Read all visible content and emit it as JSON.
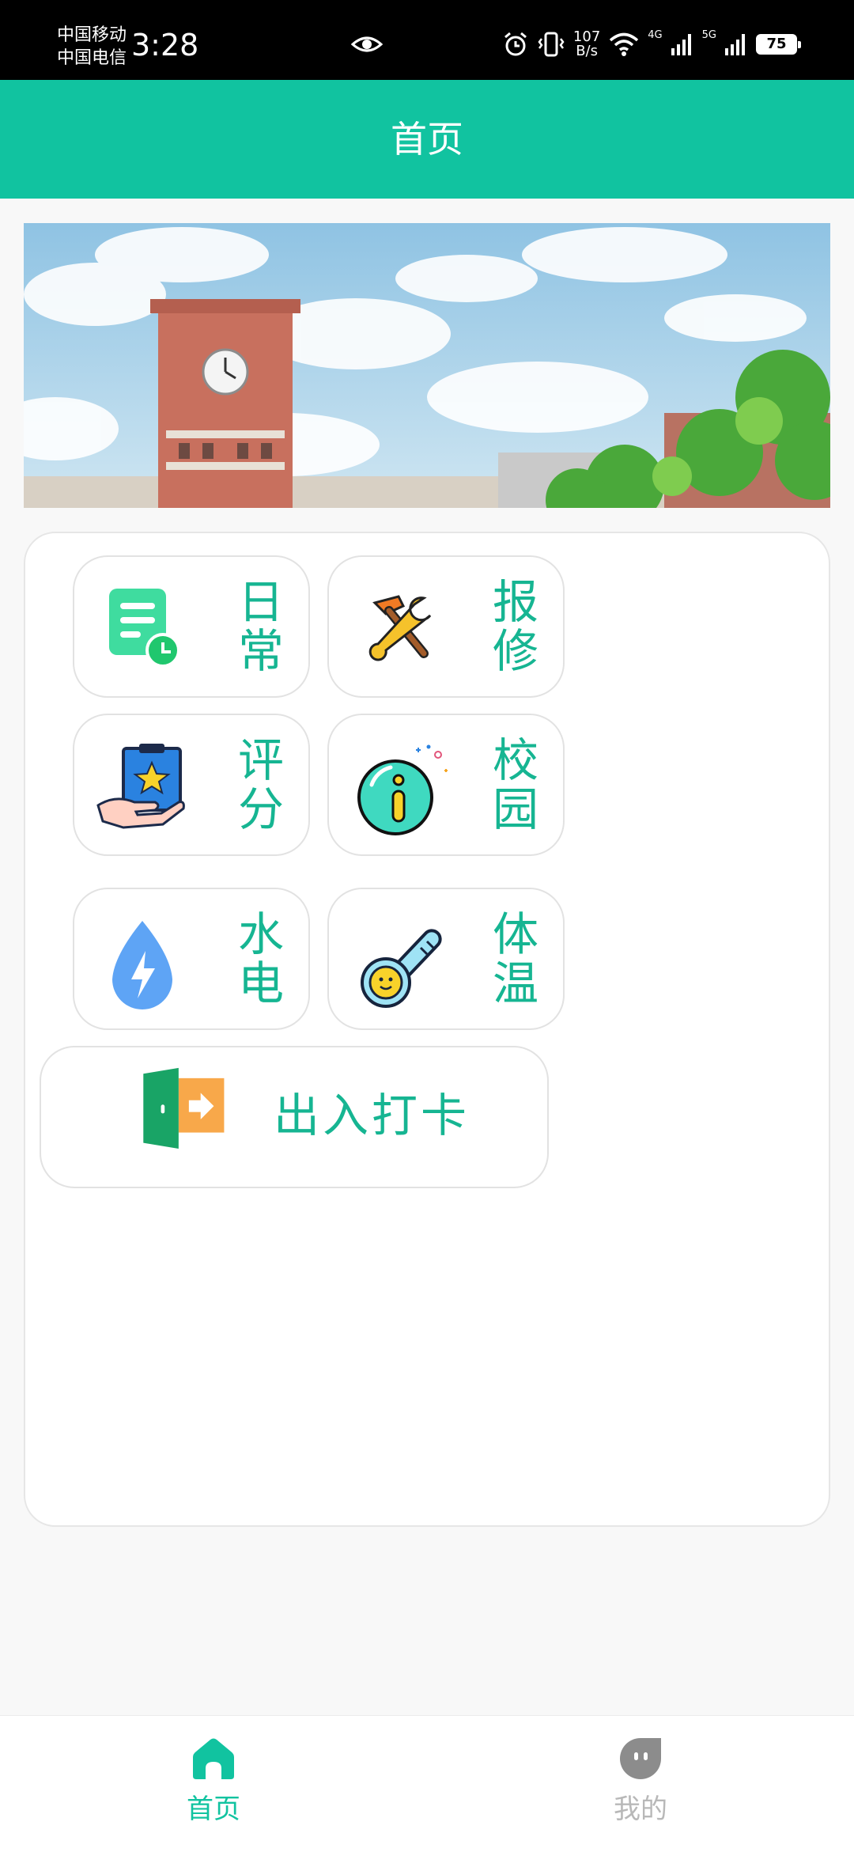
{
  "status_bar": {
    "carrier1": "中国移动",
    "carrier2": "中国电信",
    "time": "3:28",
    "net_speed_value": "107",
    "net_speed_unit": "B/s",
    "signal1_label": "4G",
    "signal2_label": "5G",
    "battery": "75"
  },
  "header": {
    "title": "首页"
  },
  "banner": {
    "image": "campus-clock-tower-banner"
  },
  "menu": {
    "items": [
      {
        "label_top": "日",
        "label_bottom": "常",
        "icon": "document-clock-icon"
      },
      {
        "label_top": "报",
        "label_bottom": "修",
        "icon": "tools-icon"
      },
      {
        "label_top": "评",
        "label_bottom": "分",
        "icon": "rating-card-icon"
      },
      {
        "label_top": "校",
        "label_bottom": "园",
        "icon": "info-icon"
      },
      {
        "label_top": "水",
        "label_bottom": "电",
        "icon": "water-power-icon"
      },
      {
        "label_top": "体",
        "label_bottom": "温",
        "icon": "thermometer-icon"
      }
    ],
    "checkin": {
      "label": "出入打卡",
      "icon": "door-exit-icon"
    }
  },
  "tab_bar": {
    "tabs": [
      {
        "label": "首页",
        "icon": "home-icon",
        "active": true
      },
      {
        "label": "我的",
        "icon": "profile-icon",
        "active": false
      }
    ],
    "active_color": "#11c3a0",
    "inactive_color": "#b8b8b8"
  },
  "colors": {
    "accent": "#11c3a0",
    "label": "#16b592"
  }
}
